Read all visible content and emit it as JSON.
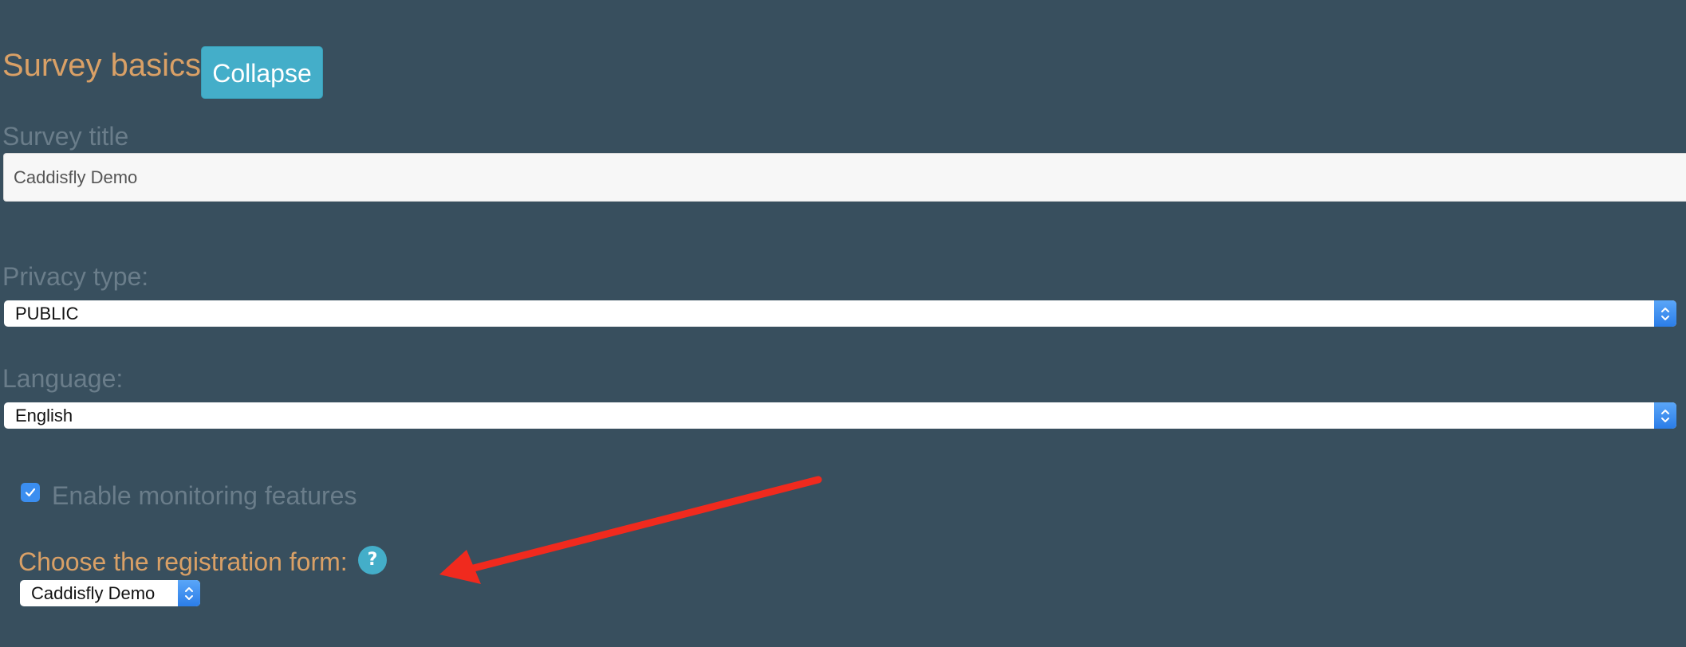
{
  "section": {
    "title": "Survey basics",
    "collapse_label": "Collapse"
  },
  "survey_title": {
    "label": "Survey title",
    "value": "Caddisfly Demo"
  },
  "privacy": {
    "label": "Privacy type:",
    "selected": "PUBLIC"
  },
  "language": {
    "label": "Language:",
    "selected": "English"
  },
  "monitoring": {
    "label": "Enable monitoring features",
    "checked": true
  },
  "registration": {
    "label": "Choose the registration form:",
    "help_glyph": "?",
    "selected": "Caddisfly Demo"
  },
  "icons": {
    "select_arrows": "chevron-up-down-icon",
    "checkbox": "checkmark-icon",
    "help": "question-mark-icon",
    "annotation": "red-arrow-icon"
  },
  "colors": {
    "background": "#384f5e",
    "heading_accent": "#d9a066",
    "muted_label": "#6a7d8a",
    "button": "#44aec9",
    "select_arrow_blue": "#2b7de8",
    "annotation_red": "#f02a1e"
  }
}
